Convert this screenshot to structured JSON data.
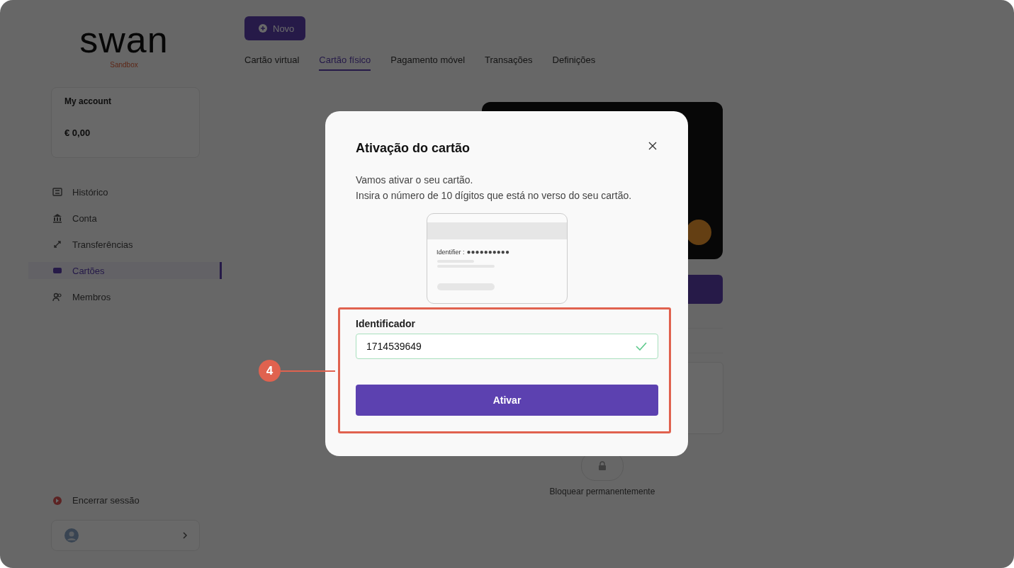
{
  "sidebar": {
    "brand": "swan",
    "brand_caption": "Sandbox",
    "account": {
      "name": "My account",
      "balance": "€ 0,00"
    },
    "nav": [
      {
        "label": "Histórico",
        "selected": false
      },
      {
        "label": "Conta",
        "selected": false
      },
      {
        "label": "Transferências",
        "selected": false
      },
      {
        "label": "Cartões",
        "selected": true
      },
      {
        "label": "Membros",
        "selected": false
      }
    ],
    "logout": "Encerrar sessão"
  },
  "main": {
    "new_button": "Novo",
    "tabs": [
      {
        "label": "Cartão virtual",
        "selected": false
      },
      {
        "label": "Cartão físico",
        "selected": true
      },
      {
        "label": "Pagamento móvel",
        "selected": false
      },
      {
        "label": "Transações",
        "selected": false
      },
      {
        "label": "Definições",
        "selected": false
      }
    ],
    "block_label": "Bloquear permanentemente"
  },
  "dialog": {
    "title": "Ativação do cartão",
    "intro": [
      "Vamos ativar o seu cartão.",
      "Insira o número de 10 dígitos que está no verso do seu cartão."
    ],
    "card_label": "Identifier :",
    "card_mask": "●●●●●●●●●●",
    "field": {
      "label": "Identificador",
      "value": "1714539649",
      "valid": true
    },
    "submit": "Ativar"
  },
  "annotation": {
    "number": "4"
  }
}
